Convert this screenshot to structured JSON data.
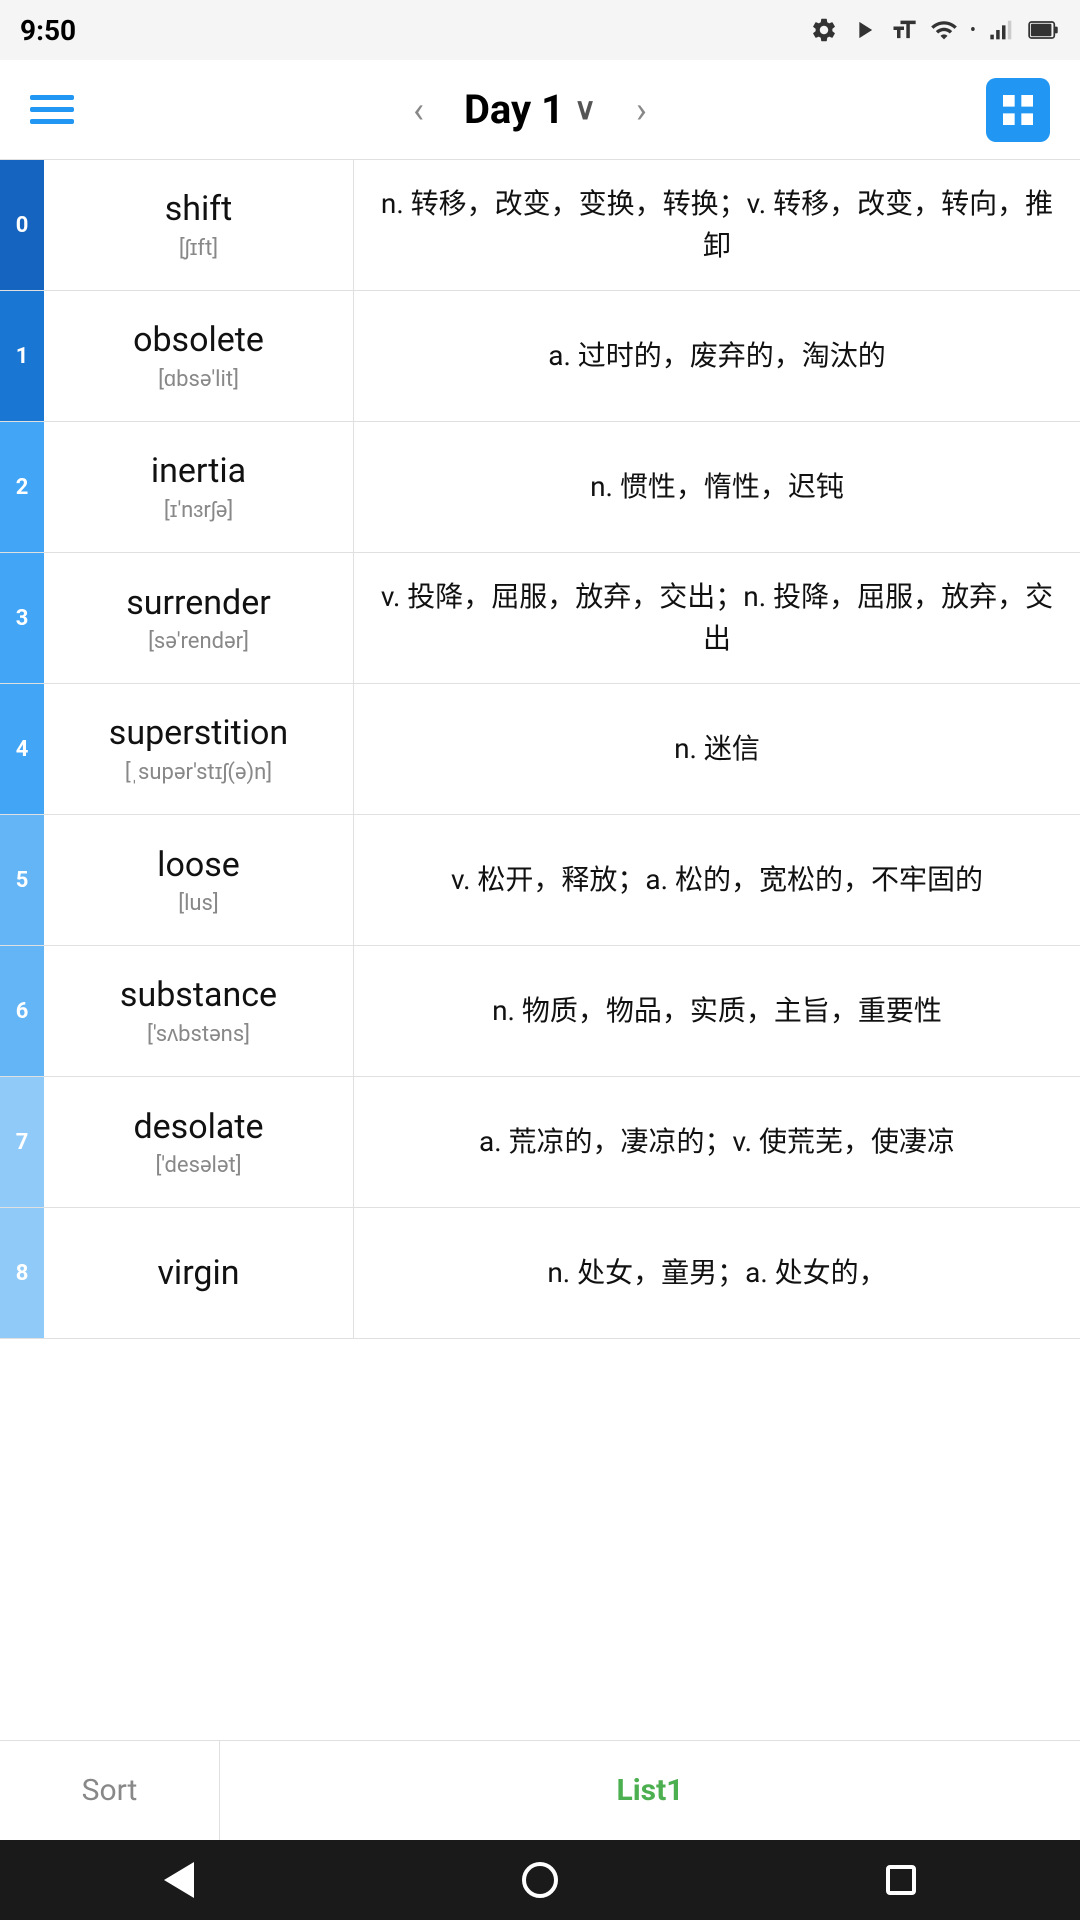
{
  "statusBar": {
    "time": "9:50",
    "icons": [
      "gear",
      "play",
      "font",
      "wifi",
      "dot",
      "signal",
      "battery"
    ]
  },
  "navBar": {
    "title": "Day 1",
    "prevArrow": "‹",
    "nextArrow": "›"
  },
  "words": [
    {
      "index": "0",
      "english": "shift",
      "phonetic": "[ʃɪft]",
      "definition": "n. 转移，改变，变换，转换；v. 转移，改变，转向，推卸",
      "colorClass": "blue-dark"
    },
    {
      "index": "1",
      "english": "obsolete",
      "phonetic": "[ɑbsə'lit]",
      "definition": "a. 过时的，废弃的，淘汰的",
      "colorClass": "blue-mid"
    },
    {
      "index": "2",
      "english": "inertia",
      "phonetic": "[ɪ'nɜrʃə]",
      "definition": "n. 惯性，惰性，迟钝",
      "colorClass": "blue-light"
    },
    {
      "index": "3",
      "english": "surrender",
      "phonetic": "[sə'rendər]",
      "definition": "v. 投降，屈服，放弃，交出；n. 投降，屈服，放弃，交出",
      "colorClass": "blue-light"
    },
    {
      "index": "4",
      "english": "superstition",
      "phonetic": "[ˌsupər'stɪʃ(ə)n]",
      "definition": "n. 迷信",
      "colorClass": "blue-light"
    },
    {
      "index": "5",
      "english": "loose",
      "phonetic": "[lus]",
      "definition": "v. 松开，释放；a. 松的，宽松的，不牢固的",
      "colorClass": "blue-pale"
    },
    {
      "index": "6",
      "english": "substance",
      "phonetic": "['sʌbstəns]",
      "definition": "n. 物质，物品，实质，主旨，重要性",
      "colorClass": "blue-pale"
    },
    {
      "index": "7",
      "english": "desolate",
      "phonetic": "['desələt]",
      "definition": "a. 荒凉的，凄凉的；v. 使荒芜，使凄凉",
      "colorClass": "blue-sky"
    },
    {
      "index": "8",
      "english": "virgin",
      "phonetic": "",
      "definition": "n. 处女，童男；a. 处女的，",
      "colorClass": "blue-sky"
    }
  ],
  "bottomTab": {
    "sortLabel": "Sort",
    "list1Label": "List1"
  },
  "androidNav": {
    "back": "back",
    "home": "home",
    "recents": "recents"
  }
}
